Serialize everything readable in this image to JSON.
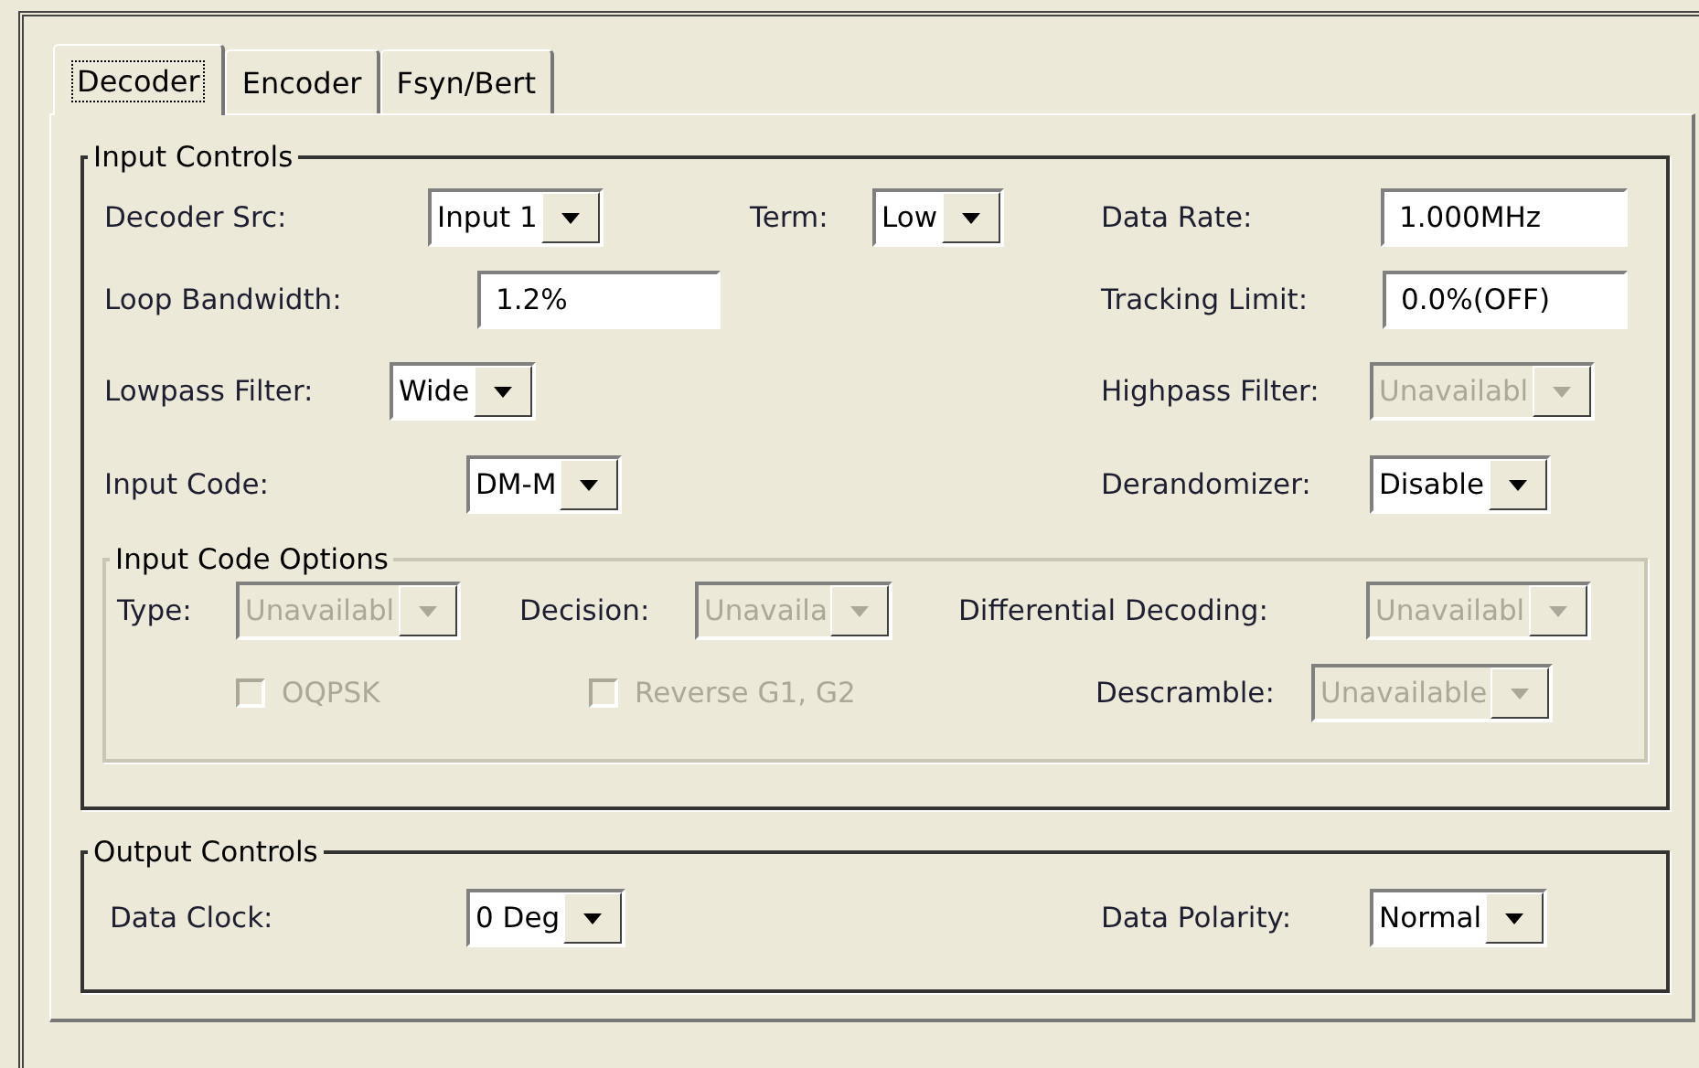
{
  "tabs": [
    {
      "label": "Decoder",
      "selected": true
    },
    {
      "label": "Encoder",
      "selected": false
    },
    {
      "label": "Fsyn/Bert",
      "selected": false
    }
  ],
  "input_controls": {
    "title": "Input Controls",
    "rows": [
      {
        "fields": [
          {
            "kind": "combo",
            "label": "Decoder Src:",
            "value": "Input 1",
            "disabled": false
          },
          {
            "kind": "combo",
            "label": "Term:",
            "value": "Low",
            "disabled": false
          },
          {
            "kind": "input",
            "label": "Data Rate:",
            "value": "1.000MHz",
            "disabled": false
          }
        ]
      },
      {
        "fields": [
          {
            "kind": "input",
            "label": "Loop Bandwidth:",
            "value": "1.2%",
            "disabled": false
          },
          {
            "kind": "input",
            "label": "Tracking Limit:",
            "value": "0.0%(OFF)",
            "disabled": false
          }
        ]
      },
      {
        "fields": [
          {
            "kind": "combo",
            "label": "Lowpass Filter:",
            "value": "Wide",
            "disabled": false
          },
          {
            "kind": "combo",
            "label": "Highpass Filter:",
            "value": "Unavailabl",
            "disabled": true
          }
        ]
      },
      {
        "fields": [
          {
            "kind": "combo",
            "label": "Input Code:",
            "value": "DM-M",
            "disabled": false
          },
          {
            "kind": "combo",
            "label": "Derandomizer:",
            "value": "Disable",
            "disabled": false
          }
        ]
      }
    ],
    "input_code_options": {
      "title": "Input Code Options",
      "rows": [
        {
          "fields": [
            {
              "kind": "combo",
              "label": "Type:",
              "value": "Unavailabl",
              "disabled": true
            },
            {
              "kind": "combo",
              "label": "Decision:",
              "value": "Unavaila",
              "disabled": true
            },
            {
              "kind": "combo",
              "label": "Differential Decoding:",
              "value": "Unavailabl",
              "disabled": true
            }
          ]
        },
        {
          "fields": [
            {
              "kind": "checkbox",
              "label": "OQPSK",
              "checked": false,
              "disabled": true
            },
            {
              "kind": "checkbox",
              "label": "Reverse G1, G2",
              "checked": false,
              "disabled": true
            },
            {
              "kind": "combo",
              "label": "Descramble:",
              "value": "Unavailable",
              "disabled": true
            }
          ]
        }
      ]
    }
  },
  "output_controls": {
    "title": "Output Controls",
    "rows": [
      {
        "fields": [
          {
            "kind": "combo",
            "label": "Data Clock:",
            "value": "0 Deg",
            "disabled": false
          },
          {
            "kind": "combo",
            "label": "Data Polarity:",
            "value": "Normal",
            "disabled": false
          }
        ]
      }
    ]
  }
}
